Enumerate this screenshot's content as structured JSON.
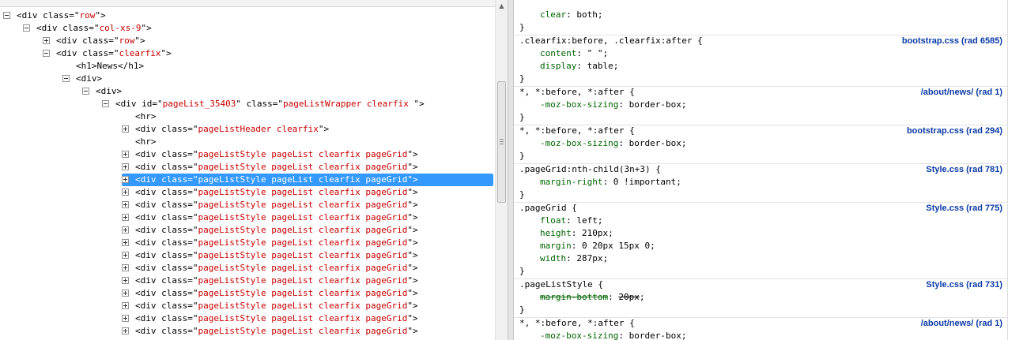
{
  "dom_tree": {
    "header_label": "",
    "nodes": [
      {
        "indent": 0,
        "toggle": "minus",
        "tag": "div",
        "attrs": [
          {
            "name": "class",
            "value": "row"
          }
        ],
        "text": ""
      },
      {
        "indent": 1,
        "toggle": "minus",
        "tag": "div",
        "attrs": [
          {
            "name": "class",
            "value": "col-xs-9"
          }
        ],
        "text": ""
      },
      {
        "indent": 2,
        "toggle": "plus",
        "tag": "div",
        "attrs": [
          {
            "name": "class",
            "value": "row"
          }
        ],
        "text": ""
      },
      {
        "indent": 2,
        "toggle": "minus",
        "tag": "div",
        "attrs": [
          {
            "name": "class",
            "value": "clearfix"
          }
        ],
        "text": ""
      },
      {
        "indent": 3,
        "toggle": "none",
        "tag": "h1",
        "attrs": [],
        "text": "News",
        "close": true
      },
      {
        "indent": 3,
        "toggle": "minus",
        "tag": "div",
        "attrs": [],
        "text": ""
      },
      {
        "indent": 4,
        "toggle": "minus",
        "tag": "div",
        "attrs": [],
        "text": ""
      },
      {
        "indent": 5,
        "toggle": "minus",
        "tag": "div",
        "attrs": [
          {
            "name": "id",
            "value": "pageList_35403"
          },
          {
            "name": "class",
            "value": "pageListWrapper clearfix "
          }
        ],
        "text": ""
      },
      {
        "indent": 6,
        "toggle": "none",
        "tag": "hr",
        "attrs": [],
        "text": ""
      },
      {
        "indent": 6,
        "toggle": "plus",
        "tag": "div",
        "attrs": [
          {
            "name": "class",
            "value": "pageListHeader clearfix"
          }
        ],
        "text": ""
      },
      {
        "indent": 6,
        "toggle": "none",
        "tag": "hr",
        "attrs": [],
        "text": ""
      },
      {
        "indent": 6,
        "toggle": "plus",
        "tag": "div",
        "attrs": [
          {
            "name": "class",
            "value": "pageListStyle pageList clearfix pageGrid"
          }
        ],
        "text": ""
      },
      {
        "indent": 6,
        "toggle": "plus",
        "tag": "div",
        "attrs": [
          {
            "name": "class",
            "value": "pageListStyle pageList clearfix pageGrid"
          }
        ],
        "text": ""
      },
      {
        "indent": 6,
        "toggle": "plus",
        "tag": "div",
        "attrs": [
          {
            "name": "class",
            "value": "pageListStyle pageList clearfix pageGrid"
          }
        ],
        "text": "",
        "selected": true
      },
      {
        "indent": 6,
        "toggle": "plus",
        "tag": "div",
        "attrs": [
          {
            "name": "class",
            "value": "pageListStyle pageList clearfix pageGrid"
          }
        ],
        "text": ""
      },
      {
        "indent": 6,
        "toggle": "plus",
        "tag": "div",
        "attrs": [
          {
            "name": "class",
            "value": "pageListStyle pageList clearfix pageGrid"
          }
        ],
        "text": ""
      },
      {
        "indent": 6,
        "toggle": "plus",
        "tag": "div",
        "attrs": [
          {
            "name": "class",
            "value": "pageListStyle pageList clearfix pageGrid"
          }
        ],
        "text": ""
      },
      {
        "indent": 6,
        "toggle": "plus",
        "tag": "div",
        "attrs": [
          {
            "name": "class",
            "value": "pageListStyle pageList clearfix pageGrid"
          }
        ],
        "text": ""
      },
      {
        "indent": 6,
        "toggle": "plus",
        "tag": "div",
        "attrs": [
          {
            "name": "class",
            "value": "pageListStyle pageList clearfix pageGrid"
          }
        ],
        "text": ""
      },
      {
        "indent": 6,
        "toggle": "plus",
        "tag": "div",
        "attrs": [
          {
            "name": "class",
            "value": "pageListStyle pageList clearfix pageGrid"
          }
        ],
        "text": ""
      },
      {
        "indent": 6,
        "toggle": "plus",
        "tag": "div",
        "attrs": [
          {
            "name": "class",
            "value": "pageListStyle pageList clearfix pageGrid"
          }
        ],
        "text": ""
      },
      {
        "indent": 6,
        "toggle": "plus",
        "tag": "div",
        "attrs": [
          {
            "name": "class",
            "value": "pageListStyle pageList clearfix pageGrid"
          }
        ],
        "text": ""
      },
      {
        "indent": 6,
        "toggle": "plus",
        "tag": "div",
        "attrs": [
          {
            "name": "class",
            "value": "pageListStyle pageList clearfix pageGrid"
          }
        ],
        "text": ""
      },
      {
        "indent": 6,
        "toggle": "plus",
        "tag": "div",
        "attrs": [
          {
            "name": "class",
            "value": "pageListStyle pageList clearfix pageGrid"
          }
        ],
        "text": ""
      },
      {
        "indent": 6,
        "toggle": "plus",
        "tag": "div",
        "attrs": [
          {
            "name": "class",
            "value": "pageListStyle pageList clearfix pageGrid"
          }
        ],
        "text": ""
      },
      {
        "indent": 6,
        "toggle": "plus",
        "tag": "div",
        "attrs": [
          {
            "name": "class",
            "value": "pageListStyle pageList clearfix pageGrid"
          }
        ],
        "text": ""
      }
    ]
  },
  "css_rules": [
    {
      "selector": "",
      "source": "",
      "props": [
        {
          "name": "clear",
          "value": "both",
          "struck": false
        }
      ]
    },
    {
      "selector": ".clearfix:before, .clearfix:after",
      "source": "bootstrap.css (rad 6585)",
      "props": [
        {
          "name": "content",
          "value": "\" \"",
          "struck": false
        },
        {
          "name": "display",
          "value": "table",
          "struck": false
        }
      ]
    },
    {
      "selector": "*, *:before, *:after",
      "source": "/about/news/ (rad 1)",
      "props": [
        {
          "name": "-moz-box-sizing",
          "value": "border-box",
          "struck": false
        }
      ]
    },
    {
      "selector": "*, *:before, *:after",
      "source": "bootstrap.css (rad 294)",
      "props": [
        {
          "name": "-moz-box-sizing",
          "value": "border-box",
          "struck": false
        }
      ]
    },
    {
      "selector": ".pageGrid:nth-child(3n+3)",
      "source": "Style.css (rad 781)",
      "props": [
        {
          "name": "margin-right",
          "value": "0 !important",
          "struck": false
        }
      ]
    },
    {
      "selector": ".pageGrid",
      "source": "Style.css (rad 775)",
      "props": [
        {
          "name": "float",
          "value": "left",
          "struck": false
        },
        {
          "name": "height",
          "value": "210px",
          "struck": false
        },
        {
          "name": "margin",
          "value": "0 20px 15px 0",
          "struck": false
        },
        {
          "name": "width",
          "value": "287px",
          "struck": false
        }
      ]
    },
    {
      "selector": ".pageListStyle",
      "source": "Style.css (rad 731)",
      "props": [
        {
          "name": "margin-bottom",
          "value": "20px",
          "struck": true
        }
      ]
    },
    {
      "selector": "*, *:before, *:after",
      "source": "/about/news/ (rad 1)",
      "props": [
        {
          "name": "-moz-box-sizing",
          "value": "border-box",
          "struck": false
        }
      ]
    }
  ],
  "colors": {
    "selection": "#3399ff",
    "attr_value": "#c80000",
    "prop_name": "#006400",
    "source_link": "#0b3aa6"
  },
  "icons": {
    "expand": "plus-box-icon",
    "collapse": "minus-box-icon",
    "scroll_up": "scroll-up-arrow-icon"
  }
}
